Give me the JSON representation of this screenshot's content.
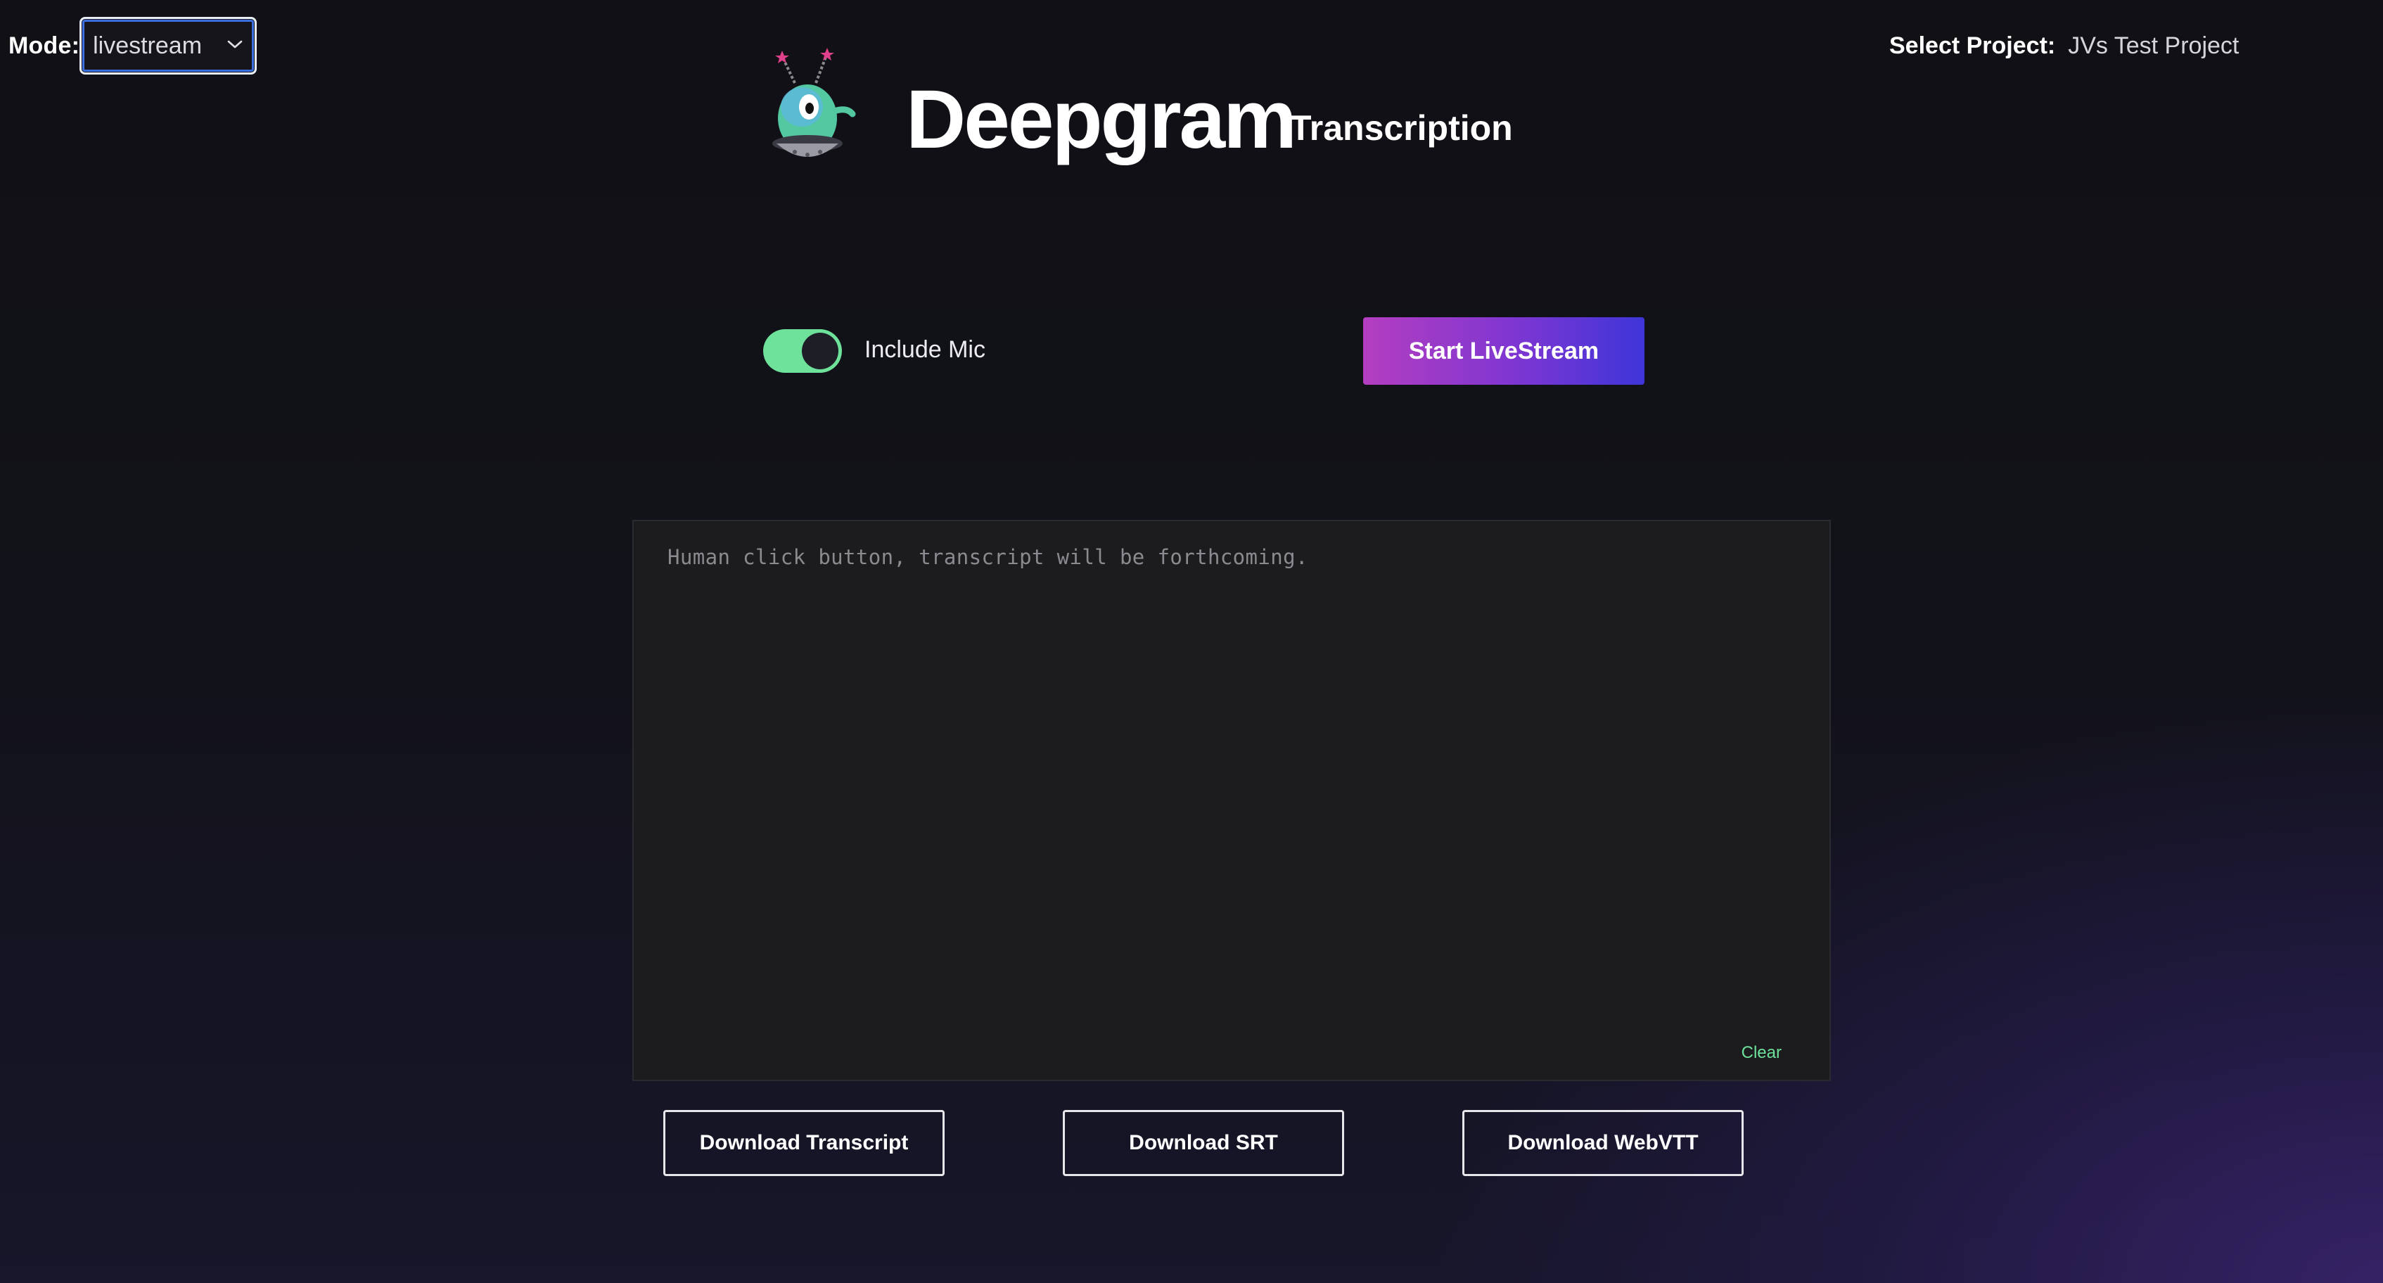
{
  "mode": {
    "label": "Mode:",
    "selected": "livestream"
  },
  "project": {
    "label": "Select Project:",
    "selected": "JVs Test Project"
  },
  "header": {
    "brand": "Deepgram",
    "subtitle": "Transcription"
  },
  "controls": {
    "include_mic_label": "Include Mic",
    "include_mic_on": true,
    "start_label": "Start LiveStream"
  },
  "transcript": {
    "placeholder": "Human click button, transcript will be forthcoming.",
    "clear_label": "Clear"
  },
  "downloads": [
    {
      "label": "Download Transcript"
    },
    {
      "label": "Download SRT"
    },
    {
      "label": "Download WebVTT"
    }
  ],
  "colors": {
    "accent_green": "#6ee29a",
    "button_gradient_start": "#b43ec0",
    "button_gradient_end": "#3e35d8"
  }
}
